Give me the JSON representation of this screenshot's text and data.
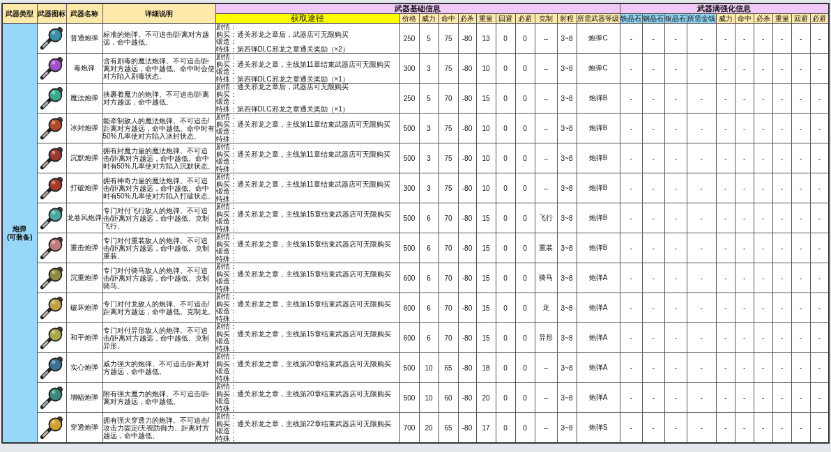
{
  "headers": {
    "left": [
      {
        "label": "武器类型"
      },
      {
        "label": "武器图标"
      },
      {
        "label": "武器名称"
      },
      {
        "label": "详细说明"
      }
    ],
    "group_basic": "武器基础信息",
    "group_upgrade": "武器满强化信息",
    "basic_columns": [
      {
        "label": "获取途径",
        "color": "#ffff00"
      },
      {
        "label": "价格",
        "color": "#fde9a9"
      },
      {
        "label": "威力",
        "color": "#fde9a9"
      },
      {
        "label": "命中",
        "color": "#fde9a9"
      },
      {
        "label": "必杀",
        "color": "#fde9a9"
      },
      {
        "label": "重量",
        "color": "#fde9a9"
      },
      {
        "label": "回避",
        "color": "#fde9a9"
      },
      {
        "label": "必避",
        "color": "#fde9a9"
      },
      {
        "label": "克制",
        "color": "#fde9a9"
      },
      {
        "label": "射程",
        "color": "#fde9a9"
      },
      {
        "label": "所需武器等级",
        "color": "#fde9a9"
      }
    ],
    "upgrade_columns": [
      {
        "label": "铁晶石",
        "color": "#8fd3f0"
      },
      {
        "label": "钢晶石",
        "color": "#8fd3f0"
      },
      {
        "label": "银晶石",
        "color": "#8fd3f0"
      },
      {
        "label": "所需金钱",
        "color": "#8fd3f0"
      },
      {
        "label": "威力",
        "color": "#fde9a9"
      },
      {
        "label": "命中",
        "color": "#fde9a9"
      },
      {
        "label": "必杀",
        "color": "#fde9a9"
      },
      {
        "label": "重量",
        "color": "#fde9a9"
      },
      {
        "label": "回避",
        "color": "#fde9a9"
      },
      {
        "label": "必避",
        "color": "#fde9a9"
      }
    ]
  },
  "weapon_type": "炮弹\n(可装备)",
  "rows": [
    {
      "name": "普通炮弹",
      "color": "#3a8fa8",
      "description": "标准的炮弹。不可追击/距离对方越远，命中越低。",
      "obtain": [
        "剧情：",
        "购买：通关邪龙之章后，武器店可无限购买",
        "锻造：",
        "特殊：第四弹DLC邪龙之章通关奖励（×2）"
      ],
      "stats": [
        "250",
        "5",
        "75",
        "-80",
        "13",
        "0",
        "0",
        "--",
        "3~8",
        "炮弹C"
      ],
      "upgrade": [
        "-",
        "-",
        "-",
        "-",
        "-",
        "-",
        "-",
        "-",
        "-",
        "-"
      ]
    },
    {
      "name": "毒炮弹",
      "color": "#a050c8",
      "description": "含有剧毒的魔法炮弹。不可追击/距离对方越远，命中越低。命中时会使对方陷入剧毒状态。",
      "obtain": [
        "剧情：",
        "购买：通关邪龙之章，主线第11章结束武器店可无限购买",
        "锻造：",
        "特殊：第四弹DLC邪龙之章通关奖励（×1）"
      ],
      "stats": [
        "300",
        "3",
        "75",
        "-80",
        "10",
        "0",
        "0",
        "--",
        "3~8",
        "炮弹C"
      ],
      "upgrade": [
        "-",
        "-",
        "-",
        "-",
        "-",
        "-",
        "-",
        "-",
        "-",
        "-"
      ]
    },
    {
      "name": "魔法炮弹",
      "color": "#3aa88a",
      "description": "挟裹着魔力的炮弹。不可追击/距离对方越远，命中越低。",
      "obtain": [
        "剧情：通关邪龙之章后，武器店可无限购买",
        "购买：",
        "锻造：",
        "特殊：第四弹DLC邪龙之章通关奖励（×1）"
      ],
      "stats": [
        "250",
        "5",
        "70",
        "-80",
        "15",
        "0",
        "0",
        "--",
        "3~8",
        "炮弹B"
      ],
      "upgrade": [
        "-",
        "-",
        "-",
        "-",
        "-",
        "-",
        "-",
        "-",
        "-",
        "-"
      ]
    },
    {
      "name": "冰封炮弹",
      "color": "#b04a2a",
      "description": "能牵制敌人的魔法炮弹。不可追击/距离对方越远，命中越低。命中时有50%几率使对方陷入冰封状态。",
      "obtain": [
        "剧情：",
        "购买：通关邪龙之章，主线第11章结束武器店可无限购买",
        "锻造：",
        "特殊："
      ],
      "stats": [
        "500",
        "3",
        "75",
        "-80",
        "10",
        "0",
        "0",
        "--",
        "3~8",
        "炮弹B"
      ],
      "upgrade": [
        "-",
        "-",
        "-",
        "-",
        "-",
        "-",
        "-",
        "-",
        "-",
        "-"
      ]
    },
    {
      "name": "沉默炮弹",
      "color": "#9a3a30",
      "description": "拥有封魔力量的魔法炮弹。不可追击/距离对方越远，命中越低。命中时有50%几率使对方陷入沉默状态。",
      "obtain": [
        "剧情：",
        "购买：通关邪龙之章，主线第11章结束武器店可无限购买",
        "锻造：",
        "特殊："
      ],
      "stats": [
        "500",
        "3",
        "75",
        "-80",
        "10",
        "0",
        "0",
        "--",
        "3~8",
        "炮弹B"
      ],
      "upgrade": [
        "-",
        "-",
        "-",
        "-",
        "-",
        "-",
        "-",
        "-",
        "-",
        "-"
      ]
    },
    {
      "name": "打破炮弹",
      "color": "#a83a2a",
      "description": "拥有神奇力量的魔法炮弹。不可追击/距离对方越远，命中越低。命中时有50%几率使对方陷入打破状态。",
      "obtain": [
        "剧情：",
        "购买：通关邪龙之章，主线第11章结束武器店可无限购买",
        "锻造：",
        "特殊："
      ],
      "stats": [
        "300",
        "3",
        "75",
        "-80",
        "10",
        "0",
        "0",
        "--",
        "3~8",
        "炮弹B"
      ],
      "upgrade": [
        "-",
        "-",
        "-",
        "-",
        "-",
        "-",
        "-",
        "-",
        "-",
        "-"
      ]
    },
    {
      "name": "龙卷风炮弹",
      "color": "#4aa8a0",
      "description": "专门对付飞行敌人的炮弹。不可追击/距离对方越远，命中越低。克制飞行。",
      "obtain": [
        "剧情：",
        "购买：通关邪龙之章，主线第15章结束武器店可无限购买",
        "锻造：",
        "特殊："
      ],
      "stats": [
        "500",
        "6",
        "70",
        "-80",
        "15",
        "0",
        "0",
        "飞行",
        "3~8",
        "炮弹B"
      ],
      "upgrade": [
        "-",
        "-",
        "-",
        "-",
        "-",
        "-",
        "-",
        "-",
        "-",
        "-"
      ]
    },
    {
      "name": "重击炮弹",
      "color": "#c07a7a",
      "description": "专门对付重装敌人的炮弹。不可追击/距离对方越远，命中越低。克制重装。",
      "obtain": [
        "剧情：",
        "购买：通关邪龙之章，主线第15章结束武器店可无限购买",
        "锻造：",
        "特殊："
      ],
      "stats": [
        "500",
        "6",
        "70",
        "-80",
        "15",
        "0",
        "0",
        "重装",
        "3~8",
        "炮弹B"
      ],
      "upgrade": [
        "-",
        "-",
        "-",
        "-",
        "-",
        "-",
        "-",
        "-",
        "-",
        "-"
      ]
    },
    {
      "name": "沉重炮弹",
      "color": "#8a8a40",
      "description": "专门对付骑马敌人的炮弹。不可追击/距离对方越远，命中越低。克制骑马。",
      "obtain": [
        "剧情：",
        "购买：通关邪龙之章，主线第15章结束武器店可无限购买",
        "锻造：",
        "特殊："
      ],
      "stats": [
        "600",
        "6",
        "70",
        "-80",
        "15",
        "0",
        "0",
        "骑马",
        "3~8",
        "炮弹A"
      ],
      "upgrade": [
        "-",
        "-",
        "-",
        "-",
        "-",
        "-",
        "-",
        "-",
        "-",
        "-"
      ]
    },
    {
      "name": "破坏炮弹",
      "color": "#c0a040",
      "description": "专门对付龙敌人的炮弹。不可追击/距离对方越远，命中越低。克制龙。",
      "obtain": [
        "剧情：",
        "购买：通关邪龙之章，主线第15章结束武器店可无限购买",
        "锻造：",
        "特殊："
      ],
      "stats": [
        "600",
        "6",
        "70",
        "-80",
        "15",
        "0",
        "0",
        "龙",
        "3~8",
        "炮弹A"
      ],
      "upgrade": [
        "-",
        "-",
        "-",
        "-",
        "-",
        "-",
        "-",
        "-",
        "-",
        "-"
      ]
    },
    {
      "name": "和平炮弹",
      "color": "#a8a848",
      "description": "专门对付异形敌人的炮弹。不可追击/距离对方越远，命中越低。克制异形。",
      "obtain": [
        "剧情：",
        "购买：通关邪龙之章，主线第15章结束武器店可无限购买",
        "锻造：",
        "特殊："
      ],
      "stats": [
        "600",
        "6",
        "70",
        "-80",
        "15",
        "0",
        "0",
        "异形",
        "3~8",
        "炮弹A"
      ],
      "upgrade": [
        "-",
        "-",
        "-",
        "-",
        "-",
        "-",
        "-",
        "-",
        "-",
        "-"
      ]
    },
    {
      "name": "实心炮弹",
      "color": "#3a7090",
      "description": "威力强大的炮弹。不可追击/距离对方越远，命中越低。",
      "obtain": [
        "剧情：",
        "购买：通关邪龙之章，主线第20章结束武器店可无限购买",
        "锻造：",
        "特殊："
      ],
      "stats": [
        "500",
        "10",
        "65",
        "-80",
        "18",
        "0",
        "0",
        "--",
        "3~8",
        "炮弹A"
      ],
      "upgrade": [
        "-",
        "-",
        "-",
        "-",
        "-",
        "-",
        "-",
        "-",
        "-",
        "-"
      ]
    },
    {
      "name": "增幅炮弹",
      "color": "#3a8a7a",
      "description": "附有强大魔力的炮弹。不可追击/距离对方越远，命中越低。",
      "obtain": [
        "剧情：",
        "购买：通关邪龙之章，主线第20章结束武器店可无限购买",
        "锻造：",
        "特殊："
      ],
      "stats": [
        "500",
        "10",
        "60",
        "-80",
        "20",
        "0",
        "0",
        "--",
        "3~8",
        "炮弹A"
      ],
      "upgrade": [
        "-",
        "-",
        "-",
        "-",
        "-",
        "-",
        "-",
        "-",
        "-",
        "-"
      ]
    },
    {
      "name": "穿透炮弹",
      "color": "#d0a030",
      "description": "拥有强大穿透力的炮弹。不可追击/攻击力固定/无视防御力。距离对方越远，命中越低。",
      "obtain": [
        "剧情：",
        "购买：通关邪龙之章，主线第22章结束武器店可无限购买",
        "锻造：",
        "特殊："
      ],
      "stats": [
        "700",
        "20",
        "65",
        "-80",
        "17",
        "0",
        "0",
        "--",
        "3~8",
        "炮弹S"
      ],
      "upgrade": [
        "-",
        "-",
        "-",
        "-",
        "-",
        "-",
        "-",
        "-",
        "-",
        "-"
      ]
    }
  ]
}
